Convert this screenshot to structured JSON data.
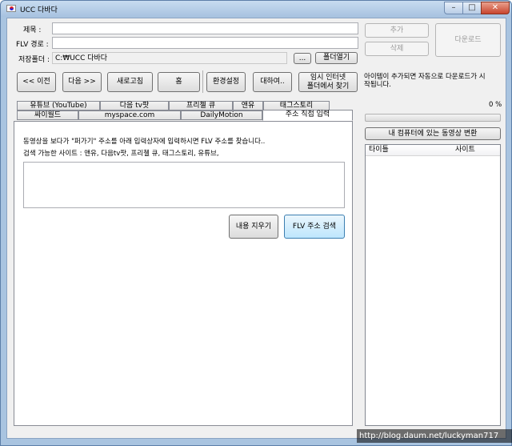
{
  "window": {
    "title": "UCC 다바다",
    "min_glyph": "–",
    "max_glyph": "□",
    "close_glyph": "✕"
  },
  "form": {
    "title_label": "제목 :",
    "title_value": "",
    "flv_label": "FLV 경로 :",
    "flv_value": "",
    "folder_label": "저장폴더 :",
    "folder_value": "C:₩UCC 다바다",
    "browse_label": "...",
    "open_folder_label": "폴더열기"
  },
  "actions": {
    "add_label": "추가",
    "delete_label": "삭제",
    "download_label": "다운로드"
  },
  "toolbar": {
    "back_label": "<< 이전",
    "next_label": "다음 >>",
    "refresh_label": "새로고침",
    "home_label": "홈",
    "settings_label": "환경설정",
    "about_label": "대하여..",
    "temp_line1": "임시 인터넷",
    "temp_line2": "폴더에서 찾기"
  },
  "notice": {
    "line1": "아이템이 추가되면 자동으로 다운로드가 시",
    "line2": "작됩니다."
  },
  "progress": {
    "percent_text": "0 %",
    "value": 0
  },
  "convert_label": "내 컴퓨터에 있는 동영상 변환",
  "tabs": {
    "row1": [
      "유튜브 (YouTube)",
      "다음 tv팟",
      "프리첼 큐",
      "앤유",
      "태그스토리"
    ],
    "row2": [
      "싸이월드",
      "myspace.com",
      "DailyMotion",
      "주소 직접 입력"
    ]
  },
  "panel": {
    "desc1": "동영상을 보다가 \"퍼가기\" 주소를 아래 입력상자에 입력하시면 FLV 주소를 찾습니다..",
    "desc2": "검색 가능한 사이트 : 앤유, 다음tv팟, 프리첼 큐, 태그스토리, 유튜브,",
    "textarea_value": "",
    "clear_label": "내용 지우기",
    "search_label": "FLV 주소 검색"
  },
  "list": {
    "col_title": "타이틀",
    "col_site": "사이트"
  },
  "watermark": "http://blog.daum.net/luckyman717"
}
